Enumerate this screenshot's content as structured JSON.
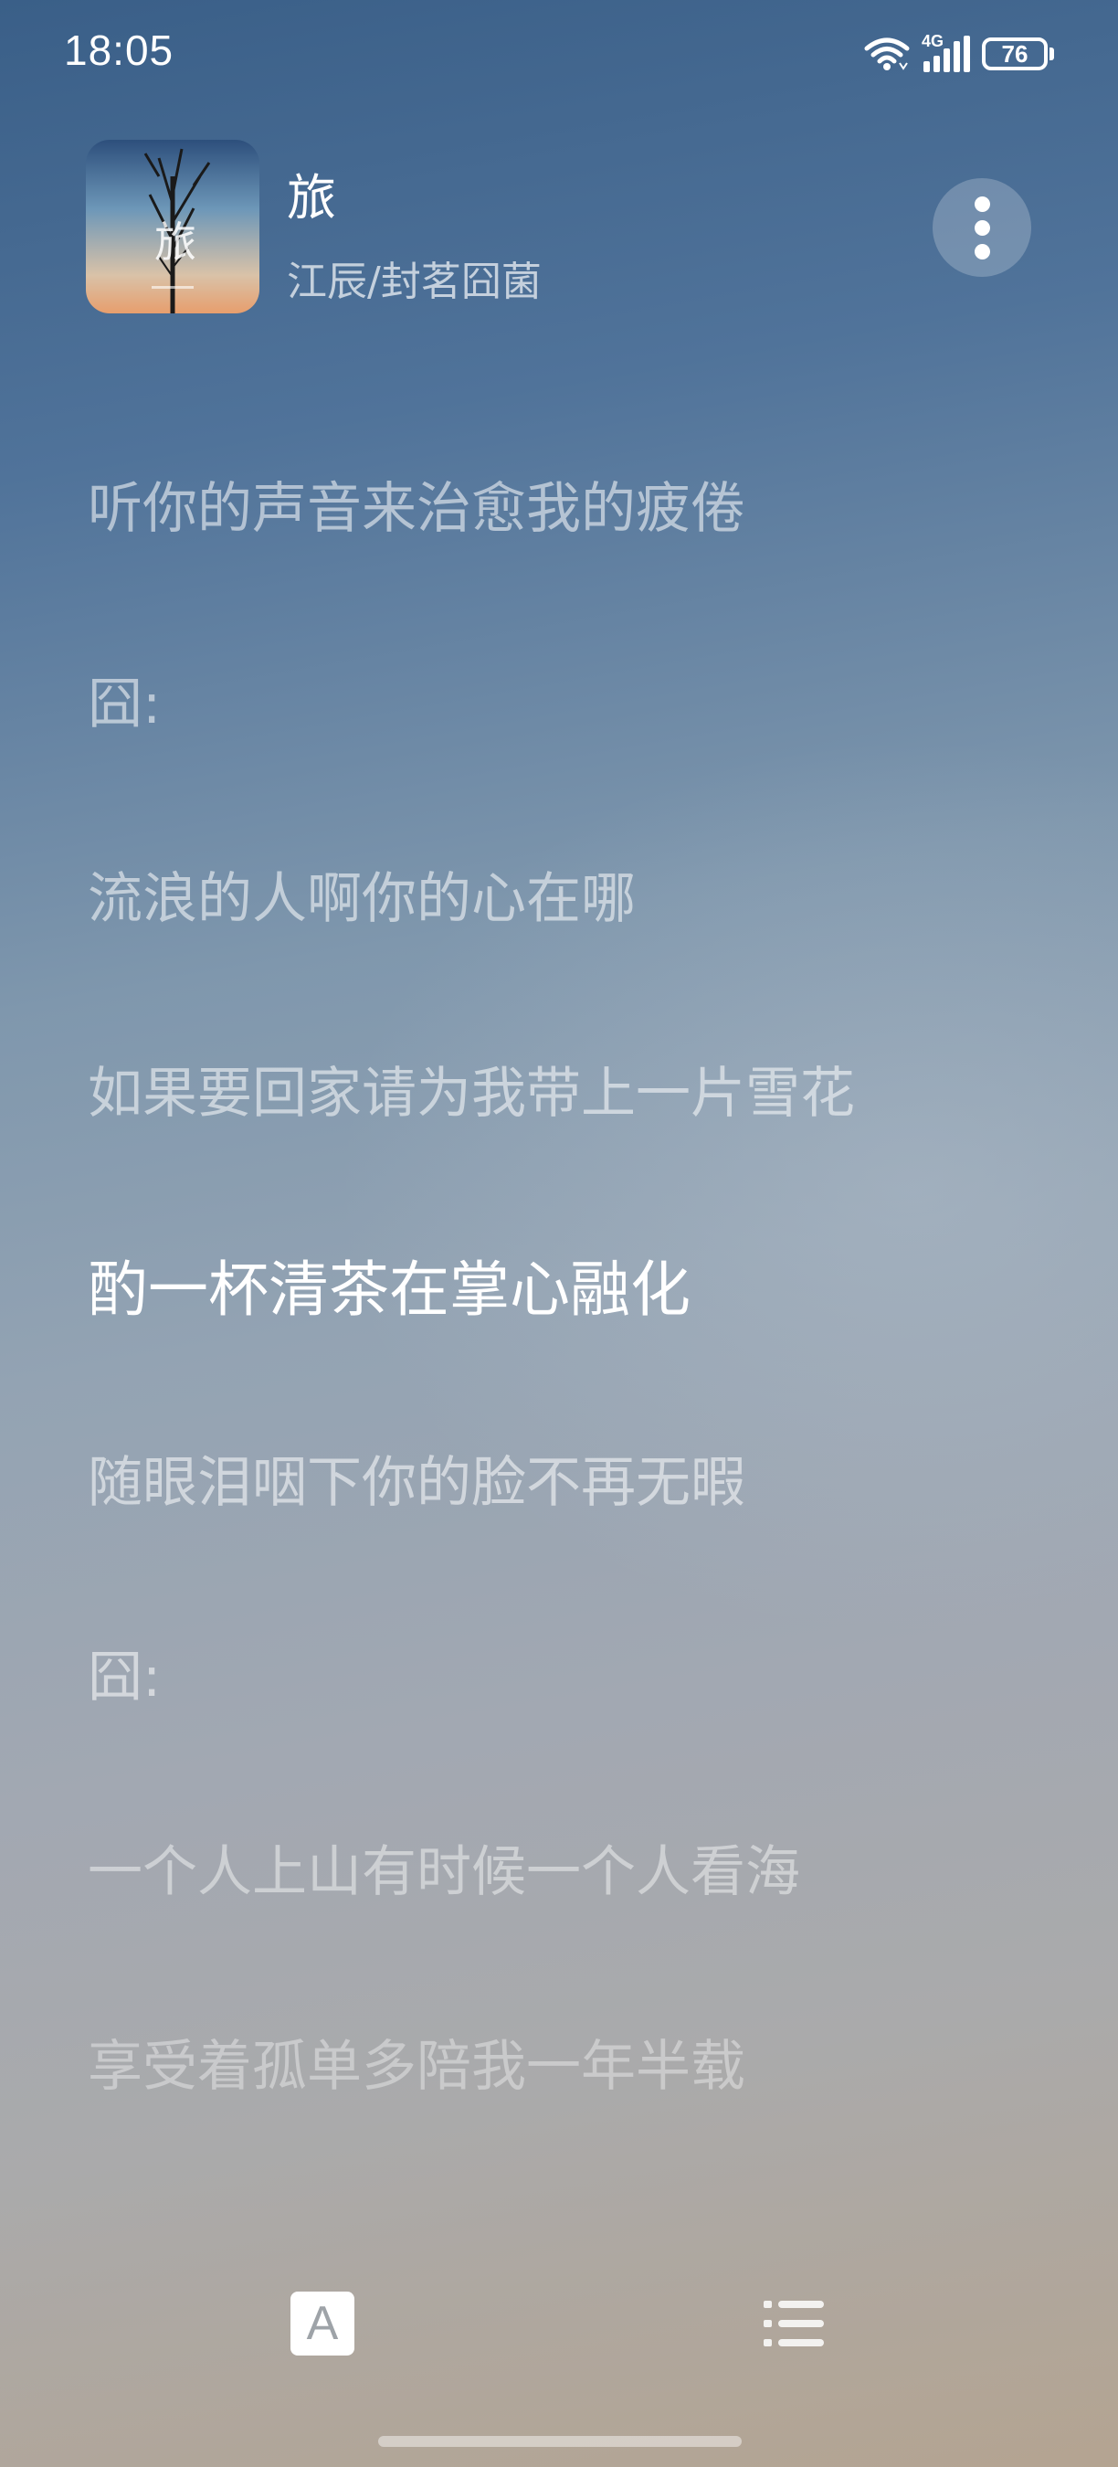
{
  "status_bar": {
    "time": "18:05",
    "network": "4G",
    "battery": "76",
    "icons": [
      "wifi-icon",
      "signal-icon",
      "battery-icon"
    ]
  },
  "song": {
    "title": "旅",
    "artist": "江辰/封茗囧菌",
    "album_art_char": "旅"
  },
  "lyrics": [
    {
      "text": "听你的声音来治愈我的疲倦",
      "state": "past"
    },
    {
      "text": "囧:",
      "state": "past"
    },
    {
      "text": "流浪的人啊你的心在哪",
      "state": "past"
    },
    {
      "text": "如果要回家请为我带上一片雪花",
      "state": "past"
    },
    {
      "text": "酌一杯清茶在掌心融化",
      "state": "current"
    },
    {
      "text": "随眼泪咽下你的脸不再无暇",
      "state": "upcoming"
    },
    {
      "text": "囧:",
      "state": "upcoming"
    },
    {
      "text": "一个人上山有时候一个人看海",
      "state": "upcoming"
    },
    {
      "text": "享受着孤单多陪我一年半载",
      "state": "upcoming"
    }
  ],
  "controls": {
    "font_button_label": "A",
    "font_button_icon": "font-size-icon",
    "list_button_icon": "playlist-icon",
    "more_button_icon": "more-vertical-icon"
  },
  "colors": {
    "background_top": "#3a5f88",
    "background_bottom": "#b4a491",
    "current_lyric": "#ffffff"
  }
}
